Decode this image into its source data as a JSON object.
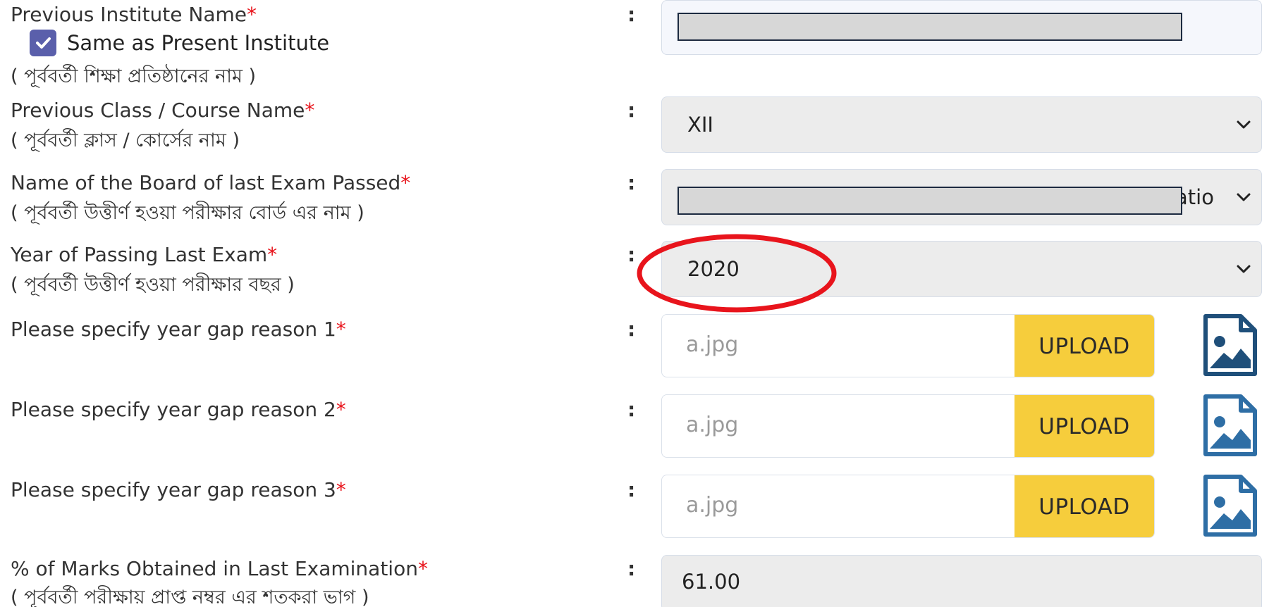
{
  "required_mark": "*",
  "separator": ":",
  "previous_institute": {
    "label_en": "Previous Institute Name",
    "label_bn": "( পূর্ববর্তী শিক্ষা প্রতিষ্ঠানের নাম )",
    "same_as_present_label": "Same as Present Institute",
    "same_as_present_checked": true
  },
  "previous_class": {
    "label_en": "Previous Class / Course Name",
    "label_bn": "( পূর্ববর্তী ক্লাস / কোর্সের নাম )",
    "selected": "XII"
  },
  "board": {
    "label_en": "Name of the Board of last Exam Passed",
    "label_bn": "( পূর্ববর্তী উত্তীর্ণ হওয়া পরীক্ষার বোর্ড এর নাম )",
    "visible_fragment": "atio"
  },
  "year_of_passing": {
    "label_en": "Year of Passing Last Exam",
    "label_bn": "( পূর্ববর্তী উত্তীর্ণ হওয়া পরীক্ষার বছর )",
    "selected": "2020",
    "annotation_color": "#e8141c"
  },
  "gap_reasons": [
    {
      "label_en": "Please specify year gap reason 1",
      "file_name": "a.jpg",
      "button": "UPLOAD"
    },
    {
      "label_en": "Please specify year gap reason 2",
      "file_name": "a.jpg",
      "button": "UPLOAD"
    },
    {
      "label_en": "Please specify year gap reason 3",
      "file_name": "a.jpg",
      "button": "UPLOAD"
    }
  ],
  "marks": {
    "label_en": "% of Marks Obtained in Last Examination",
    "label_bn": "( পূর্ববর্তী পরীক্ষায় প্রাপ্ত নম্বর এর শতকরা ভাগ )",
    "value": "61.00"
  },
  "colors": {
    "accent_checkbox": "#5a5fab",
    "upload_button": "#f6cd3c",
    "required": "#e8141c",
    "image_icon": "#2e6ea5"
  },
  "icons": [
    "check-icon",
    "chevron-down-icon",
    "image-file-icon"
  ]
}
